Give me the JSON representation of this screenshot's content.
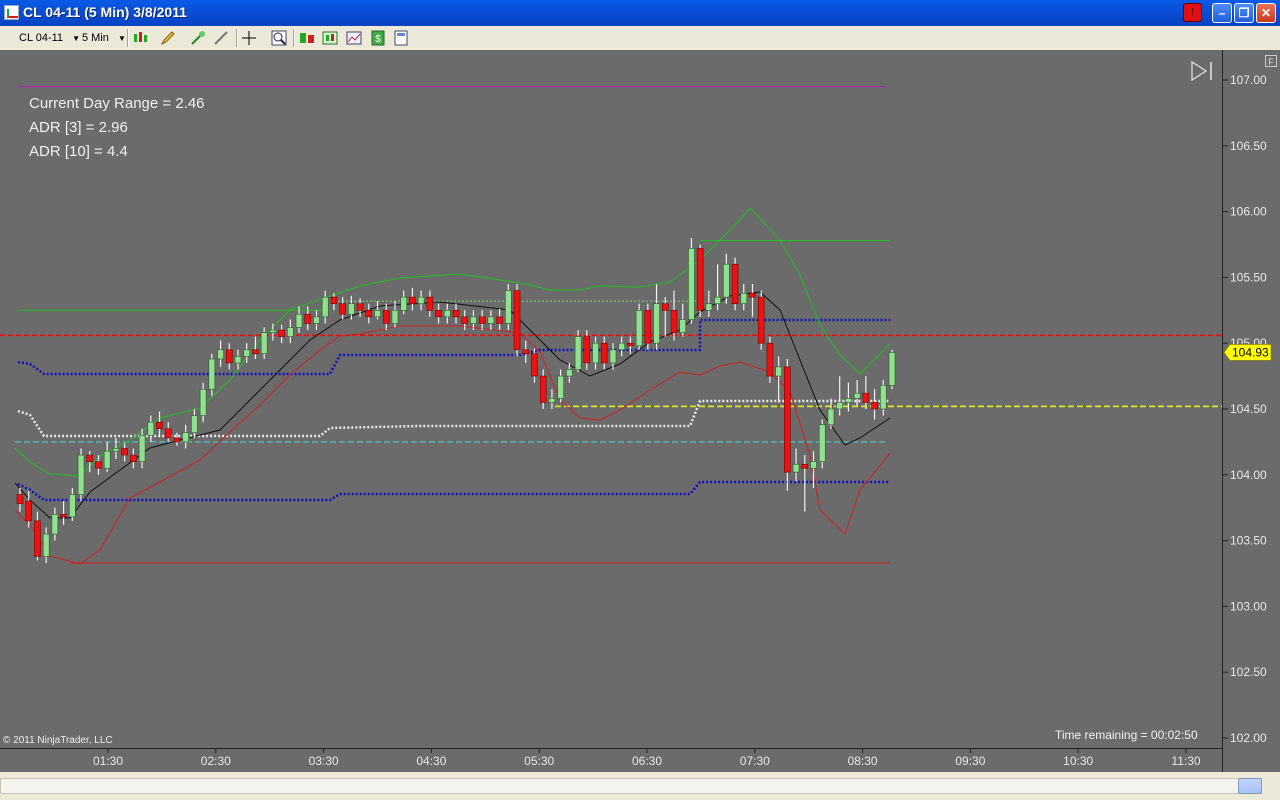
{
  "window": {
    "title": "CL 04-11 (5 Min)  3/8/2011",
    "alert_label": "!",
    "minimize": "–",
    "maximize": "❐",
    "close": "✕"
  },
  "toolbar": {
    "instrument": "CL 04-11",
    "interval": "5 Min",
    "icons": [
      "bar-style-icon",
      "pencil-icon",
      "line-tools-icon",
      "arrow-tool-icon",
      "crosshair-icon",
      "zoom-icon",
      "data-box-icon",
      "chart-trader-icon",
      "chart-style-icon",
      "save-icon",
      "properties-icon"
    ]
  },
  "info": {
    "current_day_range": "Current Day Range = 2.46",
    "adr3": "ADR [3] = 2.96",
    "adr10": "ADR [10] = 4.4"
  },
  "footer": {
    "copyright": "© 2011 NinjaTrader, LLC",
    "time_remaining": "Time remaining = 00:02:50",
    "f_label": "F"
  },
  "colors": {
    "background": "#6b6b6b",
    "up_candle": "#90e090",
    "down_candle": "#ee1111",
    "price_marker": "#ffff00"
  },
  "chart_data": {
    "type": "candlestick",
    "price_axis_ticks": [
      "107.00",
      "106.50",
      "106.00",
      "105.50",
      "105.00",
      "104.50",
      "104.00",
      "103.50",
      "103.00",
      "102.50",
      "102.00"
    ],
    "time_axis_ticks": [
      "01:30",
      "02:30",
      "03:30",
      "04:30",
      "05:30",
      "06:30",
      "07:30",
      "08:30",
      "09:30",
      "10:30",
      "11:30"
    ],
    "ylim": [
      102.0,
      107.0
    ],
    "last_price": "104.93",
    "candles": [
      [
        103.85,
        103.78,
        103.9,
        103.72
      ],
      [
        103.8,
        103.65,
        103.88,
        103.6
      ],
      [
        103.65,
        103.38,
        103.72,
        103.35
      ],
      [
        103.38,
        103.55,
        103.6,
        103.33
      ],
      [
        103.55,
        103.7,
        103.75,
        103.5
      ],
      [
        103.7,
        103.68,
        103.8,
        103.62
      ],
      [
        103.68,
        103.85,
        103.9,
        103.65
      ],
      [
        103.85,
        104.15,
        104.2,
        103.8
      ],
      [
        104.15,
        104.1,
        104.18,
        104.02
      ],
      [
        104.1,
        104.05,
        104.15,
        104.0
      ],
      [
        104.05,
        104.18,
        104.25,
        104.02
      ],
      [
        104.18,
        104.2,
        104.28,
        104.12
      ],
      [
        104.2,
        104.15,
        104.24,
        104.1
      ],
      [
        104.15,
        104.1,
        104.2,
        104.05
      ],
      [
        104.1,
        104.3,
        104.35,
        104.05
      ],
      [
        104.3,
        104.4,
        104.45,
        104.25
      ],
      [
        104.4,
        104.35,
        104.48,
        104.3
      ],
      [
        104.35,
        104.28,
        104.4,
        104.25
      ],
      [
        104.28,
        104.25,
        104.32,
        104.22
      ],
      [
        104.25,
        104.32,
        104.38,
        104.2
      ],
      [
        104.32,
        104.45,
        104.5,
        104.28
      ],
      [
        104.45,
        104.65,
        104.7,
        104.4
      ],
      [
        104.65,
        104.88,
        104.92,
        104.6
      ],
      [
        104.88,
        104.95,
        105.02,
        104.82
      ],
      [
        104.95,
        104.85,
        105.0,
        104.8
      ],
      [
        104.85,
        104.9,
        104.95,
        104.8
      ],
      [
        104.9,
        104.95,
        105.0,
        104.85
      ],
      [
        104.95,
        104.92,
        105.05,
        104.88
      ],
      [
        104.92,
        105.08,
        105.12,
        104.88
      ],
      [
        105.08,
        105.1,
        105.15,
        105.02
      ],
      [
        105.1,
        105.05,
        105.14,
        105.0
      ],
      [
        105.05,
        105.12,
        105.18,
        105.0
      ],
      [
        105.12,
        105.22,
        105.28,
        105.08
      ],
      [
        105.22,
        105.15,
        105.28,
        105.1
      ],
      [
        105.15,
        105.2,
        105.25,
        105.1
      ],
      [
        105.2,
        105.35,
        105.4,
        105.15
      ],
      [
        105.35,
        105.3,
        105.38,
        105.25
      ],
      [
        105.3,
        105.22,
        105.35,
        105.18
      ],
      [
        105.22,
        105.3,
        105.36,
        105.18
      ],
      [
        105.3,
        105.25,
        105.34,
        105.2
      ],
      [
        105.25,
        105.2,
        105.3,
        105.15
      ],
      [
        105.2,
        105.25,
        105.32,
        105.18
      ],
      [
        105.25,
        105.15,
        105.3,
        105.1
      ],
      [
        105.15,
        105.25,
        105.32,
        105.12
      ],
      [
        105.25,
        105.35,
        105.4,
        105.22
      ],
      [
        105.35,
        105.3,
        105.42,
        105.25
      ],
      [
        105.3,
        105.35,
        105.4,
        105.25
      ],
      [
        105.35,
        105.25,
        105.4,
        105.2
      ],
      [
        105.25,
        105.2,
        105.3,
        105.15
      ],
      [
        105.2,
        105.25,
        105.3,
        105.15
      ],
      [
        105.25,
        105.2,
        105.3,
        105.15
      ],
      [
        105.2,
        105.15,
        105.25,
        105.1
      ],
      [
        105.15,
        105.2,
        105.25,
        105.1
      ],
      [
        105.2,
        105.15,
        105.25,
        105.1
      ],
      [
        105.15,
        105.2,
        105.25,
        105.1
      ],
      [
        105.2,
        105.15,
        105.26,
        105.1
      ],
      [
        105.15,
        105.4,
        105.45,
        105.1
      ],
      [
        105.4,
        104.95,
        105.45,
        104.9
      ],
      [
        104.95,
        104.92,
        105.02,
        104.85
      ],
      [
        104.92,
        104.75,
        104.96,
        104.7
      ],
      [
        104.75,
        104.55,
        104.8,
        104.5
      ],
      [
        104.55,
        104.58,
        104.65,
        104.5
      ],
      [
        104.58,
        104.75,
        104.8,
        104.55
      ],
      [
        104.75,
        104.8,
        104.85,
        104.7
      ],
      [
        104.8,
        105.05,
        105.1,
        104.78
      ],
      [
        105.05,
        104.85,
        105.1,
        104.8
      ],
      [
        104.85,
        105.0,
        105.05,
        104.8
      ],
      [
        105.0,
        104.85,
        105.05,
        104.8
      ],
      [
        104.85,
        104.95,
        105.0,
        104.8
      ],
      [
        104.95,
        105.0,
        105.05,
        104.9
      ],
      [
        105.0,
        104.98,
        105.05,
        104.92
      ],
      [
        104.98,
        105.25,
        105.3,
        104.95
      ],
      [
        105.25,
        105.0,
        105.3,
        104.95
      ],
      [
        105.0,
        105.3,
        105.45,
        104.95
      ],
      [
        105.3,
        105.25,
        105.35,
        105.05
      ],
      [
        105.25,
        105.08,
        105.4,
        105.02
      ],
      [
        105.08,
        105.18,
        105.3,
        105.05
      ],
      [
        105.18,
        105.72,
        105.8,
        105.15
      ],
      [
        105.72,
        105.25,
        105.75,
        105.2
      ],
      [
        105.25,
        105.3,
        105.4,
        105.2
      ],
      [
        105.3,
        105.35,
        105.6,
        105.25
      ],
      [
        105.35,
        105.6,
        105.68,
        105.3
      ],
      [
        105.6,
        105.3,
        105.65,
        105.25
      ],
      [
        105.3,
        105.38,
        105.45,
        105.25
      ],
      [
        105.38,
        105.35,
        105.45,
        105.2
      ],
      [
        105.35,
        105.0,
        105.4,
        104.95
      ],
      [
        105.0,
        104.75,
        105.05,
        104.7
      ],
      [
        104.75,
        104.82,
        104.9,
        104.55
      ],
      [
        104.82,
        104.02,
        104.88,
        103.88
      ],
      [
        104.02,
        104.08,
        104.2,
        103.95
      ],
      [
        104.08,
        104.05,
        104.15,
        103.72
      ],
      [
        104.05,
        104.1,
        104.18,
        103.9
      ],
      [
        104.1,
        104.38,
        104.42,
        104.05
      ],
      [
        104.38,
        104.5,
        104.58,
        104.35
      ],
      [
        104.5,
        104.55,
        104.75,
        104.45
      ],
      [
        104.55,
        104.58,
        104.7,
        104.48
      ],
      [
        104.58,
        104.62,
        104.72,
        104.52
      ],
      [
        104.62,
        104.55,
        104.75,
        104.5
      ],
      [
        104.55,
        104.5,
        104.65,
        104.42
      ],
      [
        104.5,
        104.68,
        104.72,
        104.45
      ],
      [
        104.68,
        104.93,
        104.95,
        104.65
      ]
    ]
  }
}
